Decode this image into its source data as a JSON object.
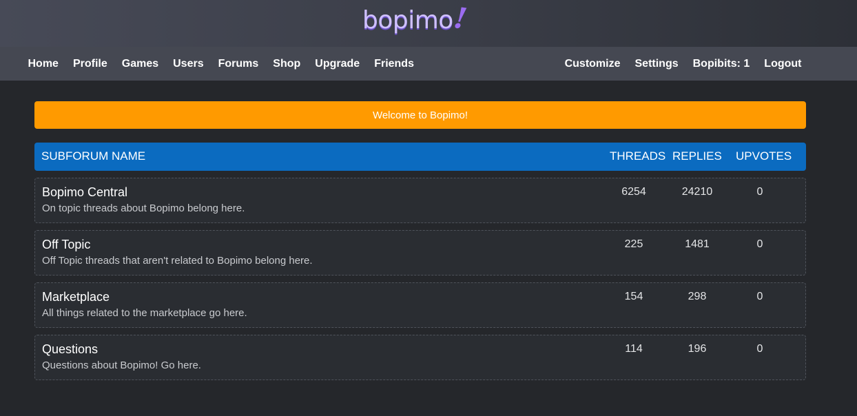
{
  "logo": {
    "text": "bopimo",
    "mark": "!"
  },
  "nav": {
    "left": [
      "Home",
      "Profile",
      "Games",
      "Users",
      "Forums",
      "Shop",
      "Upgrade",
      "Friends"
    ],
    "right": [
      "Customize",
      "Settings",
      "Bopibits: 1",
      "Logout"
    ]
  },
  "banner": {
    "text": "Welcome to Bopimo!",
    "color": "#ff9a00"
  },
  "table": {
    "headers": {
      "name": "SUBFORUM NAME",
      "threads": "THREADS",
      "replies": "REPLIES",
      "upvotes": "UPVOTES"
    },
    "header_color": "#0b6bc0",
    "rows": [
      {
        "title": "Bopimo Central",
        "description": "On topic threads about Bopimo belong here.",
        "threads": "6254",
        "replies": "24210",
        "upvotes": "0"
      },
      {
        "title": "Off Topic",
        "description": "Off Topic threads that aren't related to Bopimo belong here.",
        "threads": "225",
        "replies": "1481",
        "upvotes": "0"
      },
      {
        "title": "Marketplace",
        "description": "All things related to the marketplace go here.",
        "threads": "154",
        "replies": "298",
        "upvotes": "0"
      },
      {
        "title": "Questions",
        "description": "Questions about Bopimo! Go here.",
        "threads": "114",
        "replies": "196",
        "upvotes": "0"
      }
    ]
  }
}
